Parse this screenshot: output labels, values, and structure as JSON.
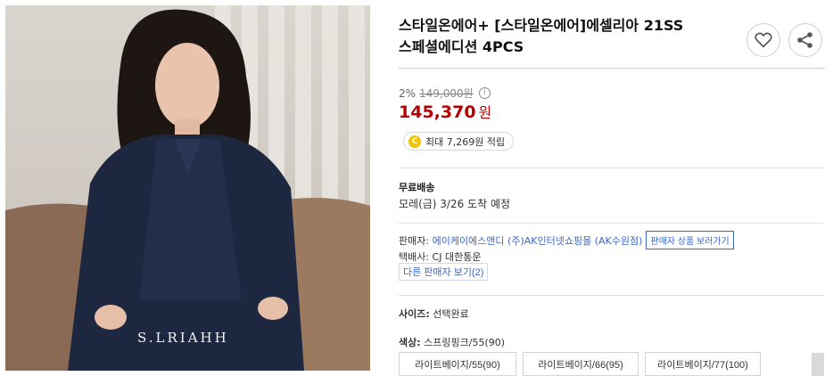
{
  "product": {
    "title_line1": "스타일온에어+ [스타일온에어]에셀리아 21SS",
    "title_line2": "스페셜에디션 4PCS",
    "photo_brand": "S.LRIAHH"
  },
  "actions": {
    "wish_icon": "heart-icon",
    "share_icon": "share-icon"
  },
  "pricing": {
    "discount_rate": "2%",
    "original_price": "149,000원",
    "info_icon": "ⓘ",
    "sale_price": "145,370",
    "currency": "원",
    "reward_coin": "C",
    "reward_text": "최대 7,269원 적립"
  },
  "shipping": {
    "label": "무료배송",
    "eta": "모레(금) 3/26 도착 예정"
  },
  "seller": {
    "label": "판매자:",
    "name": "에이케이에스앤디 (주)AK인터넷쇼핑몰 (AK수원점)",
    "products_button": "판매자 상품 보러가기",
    "courier": "택배사: CJ 대한통운",
    "other_sellers": "다른 판매자 보기(2)"
  },
  "options": {
    "size_label": "사이즈:",
    "size_value": "선택완료",
    "color_label": "색상:",
    "color_value": "스프링핑크/55(90)",
    "items": [
      "라이트베이지/55(90)",
      "라이트베이지/66(95)",
      "라이트베이지/77(100)"
    ]
  },
  "colors": {
    "price_red": "#b40000",
    "link_blue": "#3c67c8",
    "coin_yellow": "#f2c200"
  }
}
